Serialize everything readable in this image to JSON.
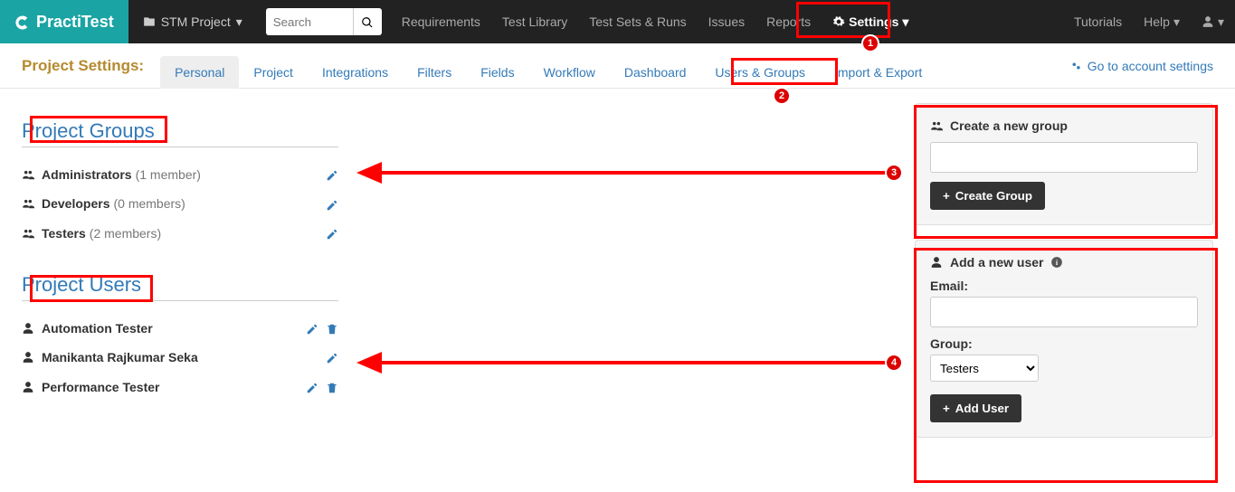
{
  "logo": "PractiTest",
  "project_dropdown": "STM Project",
  "search": {
    "placeholder": "Search"
  },
  "topnav": {
    "requirements": "Requirements",
    "test_library": "Test Library",
    "test_sets_runs": "Test Sets & Runs",
    "issues": "Issues",
    "reports": "Reports",
    "settings": "Settings",
    "tutorials": "Tutorials",
    "help": "Help"
  },
  "subheader": {
    "title": "Project Settings:",
    "tabs": {
      "personal": "Personal",
      "project": "Project",
      "integrations": "Integrations",
      "filters": "Filters",
      "fields": "Fields",
      "workflow": "Workflow",
      "dashboard": "Dashboard",
      "users_groups": "Users & Groups",
      "import_export": "Import & Export"
    },
    "account_link": "Go to account settings"
  },
  "sections": {
    "groups_title": "Project Groups",
    "users_title": "Project Users"
  },
  "groups": [
    {
      "name": "Administrators",
      "meta": "(1 member)"
    },
    {
      "name": "Developers",
      "meta": "(0 members)"
    },
    {
      "name": "Testers",
      "meta": "(2 members)"
    }
  ],
  "users": [
    {
      "name": "Automation Tester",
      "trash": true
    },
    {
      "name": "Manikanta Rajkumar Seka",
      "trash": false
    },
    {
      "name": "Performance Tester",
      "trash": true
    }
  ],
  "create_group": {
    "title": "Create a new group",
    "button": "Create Group"
  },
  "add_user": {
    "title": "Add a new user",
    "email_label": "Email:",
    "group_label": "Group:",
    "group_selected": "Testers",
    "button": "Add User"
  },
  "annotations": {
    "b1": "1",
    "b2": "2",
    "b3": "3",
    "b4": "4"
  }
}
